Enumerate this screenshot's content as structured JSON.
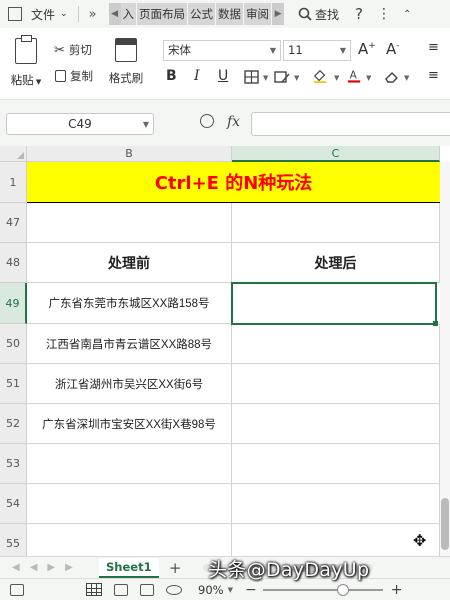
{
  "menu": {
    "file_label": "文件",
    "more": "»",
    "tabs": [
      "入",
      "页面布局",
      "公式",
      "数据",
      "审阅"
    ],
    "search_label": "查找"
  },
  "ribbon": {
    "paste": "粘贴",
    "cut": "剪切",
    "copy": "复制",
    "format_painter": "格式刷",
    "font_name": "宋体",
    "font_size": "11",
    "bold": "B",
    "italic": "I",
    "underline": "U"
  },
  "formula_bar": {
    "name_box": "C49",
    "fx": "fx",
    "value": ""
  },
  "columns": [
    {
      "label": "B",
      "selected": false
    },
    {
      "label": "C",
      "selected": true
    }
  ],
  "rows": [
    {
      "num": "1",
      "selected": false
    },
    {
      "num": "47",
      "selected": false
    },
    {
      "num": "48",
      "selected": false
    },
    {
      "num": "49",
      "selected": true
    },
    {
      "num": "50",
      "selected": false
    },
    {
      "num": "51",
      "selected": false
    },
    {
      "num": "52",
      "selected": false
    },
    {
      "num": "53",
      "selected": false
    },
    {
      "num": "54",
      "selected": false
    },
    {
      "num": "55",
      "selected": false
    }
  ],
  "sheet": {
    "title": "Ctrl+E 的N种玩法",
    "header_before": "处理前",
    "header_after": "处理后",
    "addresses": [
      "广东省东莞市东城区XX路158号",
      "江西省南昌市青云谱区XX路88号",
      "浙江省湖州市吴兴区XX街6号",
      "广东省深圳市宝安区XX街X巷98号"
    ]
  },
  "sheet_tabs": {
    "active": "Sheet1",
    "add": "+"
  },
  "status": {
    "zoom": "90%",
    "zoom_level": 0.62
  },
  "watermark": "头条@DayDayUp",
  "colors": {
    "accent": "#217346",
    "title_bg": "#ffff00",
    "title_text": "#ff0000"
  }
}
